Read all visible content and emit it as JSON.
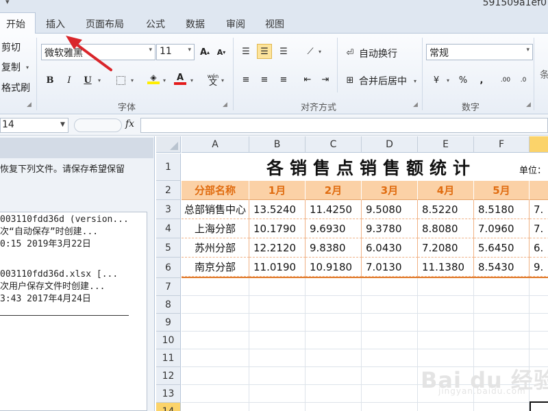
{
  "window": {
    "title": "591509a1ef0",
    "qat_dropdown": "▾"
  },
  "tabs": [
    {
      "label": "开始"
    },
    {
      "label": "插入"
    },
    {
      "label": "页面布局"
    },
    {
      "label": "公式"
    },
    {
      "label": "数据"
    },
    {
      "label": "审阅"
    },
    {
      "label": "视图"
    }
  ],
  "ribbon": {
    "clipboard": {
      "cut": "剪切",
      "copy": "复制",
      "format_painter": "格式刷"
    },
    "font": {
      "name": "微软雅黑",
      "size": "11",
      "group_label": "字体",
      "bold": "B",
      "italic": "I",
      "underline": "U",
      "grow": "A",
      "shrink": "A",
      "phonetic": "wén"
    },
    "alignment": {
      "wrap_text": "自动换行",
      "merge_center": "合并后居中",
      "group_label": "对齐方式"
    },
    "number": {
      "format": "常规",
      "group_label": "数字",
      "percent": "%",
      "comma": ","
    },
    "styles": {
      "partial_label": "条"
    }
  },
  "formula_bar": {
    "name_box": "14",
    "fx": "fx"
  },
  "recovery": {
    "message": "恢复下列文件。请保存希望保留",
    "files": [
      {
        "line1": "003110fdd36d (version...",
        "line2": "次“自动保存”时创建...",
        "line3": "0:15 2019年3月22日"
      },
      {
        "line1": "003110fdd36d.xlsx  [...",
        "line2": "次用户保存文件时创建...",
        "line3": "3:43 2017年4月24日"
      }
    ]
  },
  "sheet": {
    "columns": [
      "A",
      "B",
      "C",
      "D",
      "E",
      "F",
      ""
    ],
    "rows": [
      "1",
      "2",
      "3",
      "4",
      "5",
      "6",
      "7",
      "8",
      "9",
      "10",
      "11",
      "12",
      "13",
      "14"
    ],
    "title": "各销售点销售额统计",
    "unit": "单位：",
    "header": [
      "分部名称",
      "1月",
      "2月",
      "3月",
      "4月",
      "5月"
    ],
    "data": [
      [
        "总部销售中心",
        "13.5240",
        "11.4250",
        "9.5080",
        "8.5220",
        "8.5180",
        "7."
      ],
      [
        "上海分部",
        "10.1790",
        "9.6930",
        "9.3780",
        "8.8080",
        "7.0960",
        "7."
      ],
      [
        "苏州分部",
        "12.2120",
        "9.8380",
        "6.0430",
        "7.2080",
        "5.6450",
        "6."
      ],
      [
        "南京分部",
        "11.0190",
        "10.9180",
        "7.0130",
        "11.1380",
        "8.5430",
        "9."
      ]
    ]
  },
  "watermark": {
    "main": "Bai du 经验",
    "sub": "jingyan.baidu.com"
  },
  "colors": {
    "header_fill": "#fbd1a6",
    "header_text": "#e06c10",
    "selected_header": "#fbd36a",
    "arrow": "#d9262b"
  }
}
